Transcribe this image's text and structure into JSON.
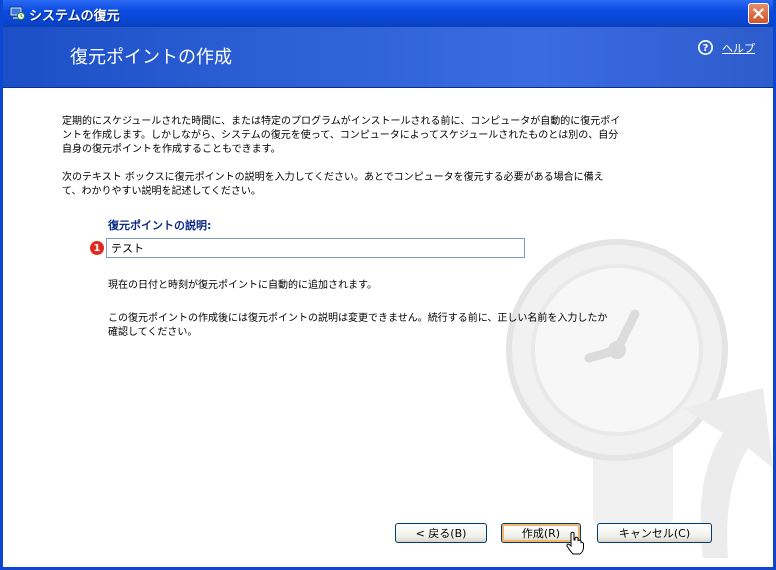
{
  "window": {
    "title": "システムの復元",
    "accent_color": "#0b47d1"
  },
  "header": {
    "title": "復元ポイントの作成",
    "help_label": "ヘルプ"
  },
  "body": {
    "paragraph1": "定期的にスケジュールされた時間に、または特定のプログラムがインストールされる前に、コンピュータが自動的に復元ポイントを作成します。しかしながら、システムの復元を使って、コンピュータによってスケジュールされたものとは別の、自分自身の復元ポイントを作成することもできます。",
    "paragraph2": "次のテキスト ボックスに復元ポイントの説明を入力してください。あとでコンピュータを復元する必要がある場合に備えて、わかりやすい説明を記述してください。",
    "field_label": "復元ポイントの説明:",
    "badge": "1",
    "description_value": "テスト",
    "note1": "現在の日付と時刻が復元ポイントに自動的に追加されます。",
    "note2": "この復元ポイントの作成後には復元ポイントの説明は変更できません。続行する前に、正しい名前を入力したか確認してください。"
  },
  "buttons": {
    "back": "< 戻る(B)",
    "create": "作成(R)",
    "cancel": "キャンセル(C)"
  },
  "icons": {
    "title": "system-restore-icon",
    "close": "close-icon",
    "help": "help-icon",
    "cursor": "hand-cursor-icon"
  }
}
